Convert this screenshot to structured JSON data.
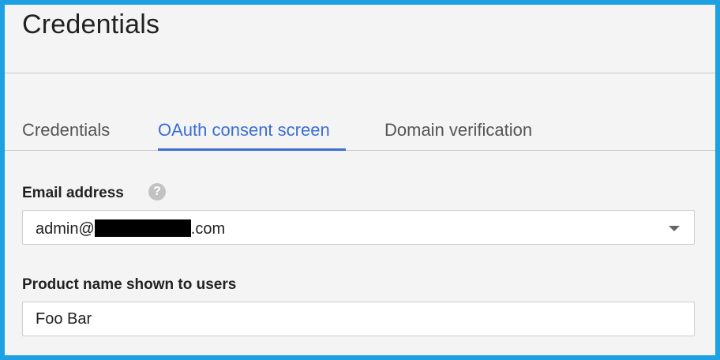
{
  "page": {
    "title": "Credentials"
  },
  "tabs": [
    {
      "label": "Credentials",
      "active": false
    },
    {
      "label": "OAuth consent screen",
      "active": true
    },
    {
      "label": "Domain verification",
      "active": false
    }
  ],
  "email_field": {
    "label": "Email address",
    "value_prefix": "admin@",
    "value_suffix": ".com",
    "help_icon": "help-circle-icon",
    "help_glyph": "?"
  },
  "product_field": {
    "label": "Product name shown to users",
    "value": "Foo Bar"
  },
  "colors": {
    "accent": "#3b6fd3",
    "frame_border": "#1da1e2"
  }
}
